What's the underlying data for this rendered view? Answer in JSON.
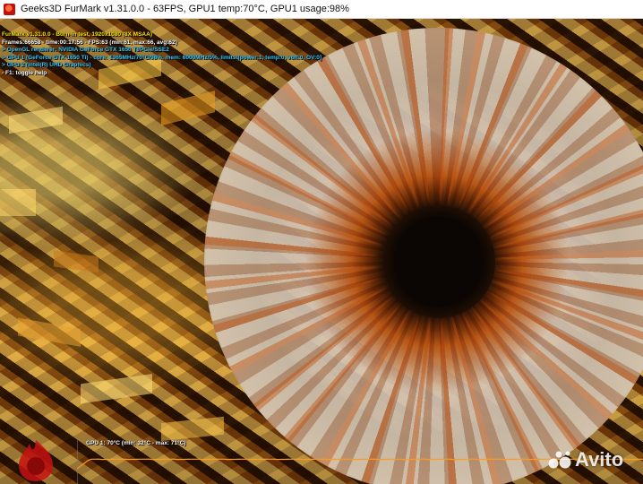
{
  "window": {
    "title": "Geeks3D FurMark v1.31.0.0 - 63FPS, GPU1 temp:70°C, GPU1 usage:98%"
  },
  "osd": {
    "lines": [
      {
        "text": "FurMark v1.31.0.0 - Burn-in test, 1920x1080 (8X MSAA)",
        "color": "#ffe600"
      },
      {
        "text": "Frames:66658 - time:00:17:56 - FPS:63 (min:61, max:66, avg:62)",
        "color": "#ffffff"
      },
      {
        "text": "> OpenGL renderer: NVIDIA GeForce GTX 1650 Ti/PCIe/SSE2",
        "color": "#35c8ff"
      },
      {
        "text": "> GPU 1 (GeForce GTX 1650 Ti) - core: 1365MHz/70°C/98%, mem: 6000MHz/5%, limits:[power:1, temp:0, volt:0, OV:0]",
        "color": "#35c8ff"
      },
      {
        "text": "> GPU 2 (Intel(R) UHD Graphics)",
        "color": "#35c8ff"
      },
      {
        "text": "- F1: toggle help",
        "color": "#ffffff"
      }
    ]
  },
  "temperature_graph": {
    "label": "GPU 1: 70°C (min: 32°C - max: 71°C)",
    "current_c": 70,
    "min_c": 32,
    "max_c": 71,
    "line_color": "#ff9a1a",
    "label_color": "#ffffff"
  },
  "logo": {
    "icon": "furmark-logo-icon",
    "color": "#c51111"
  },
  "watermark": {
    "text": "Avito",
    "icon": "avito-dots-icon"
  }
}
